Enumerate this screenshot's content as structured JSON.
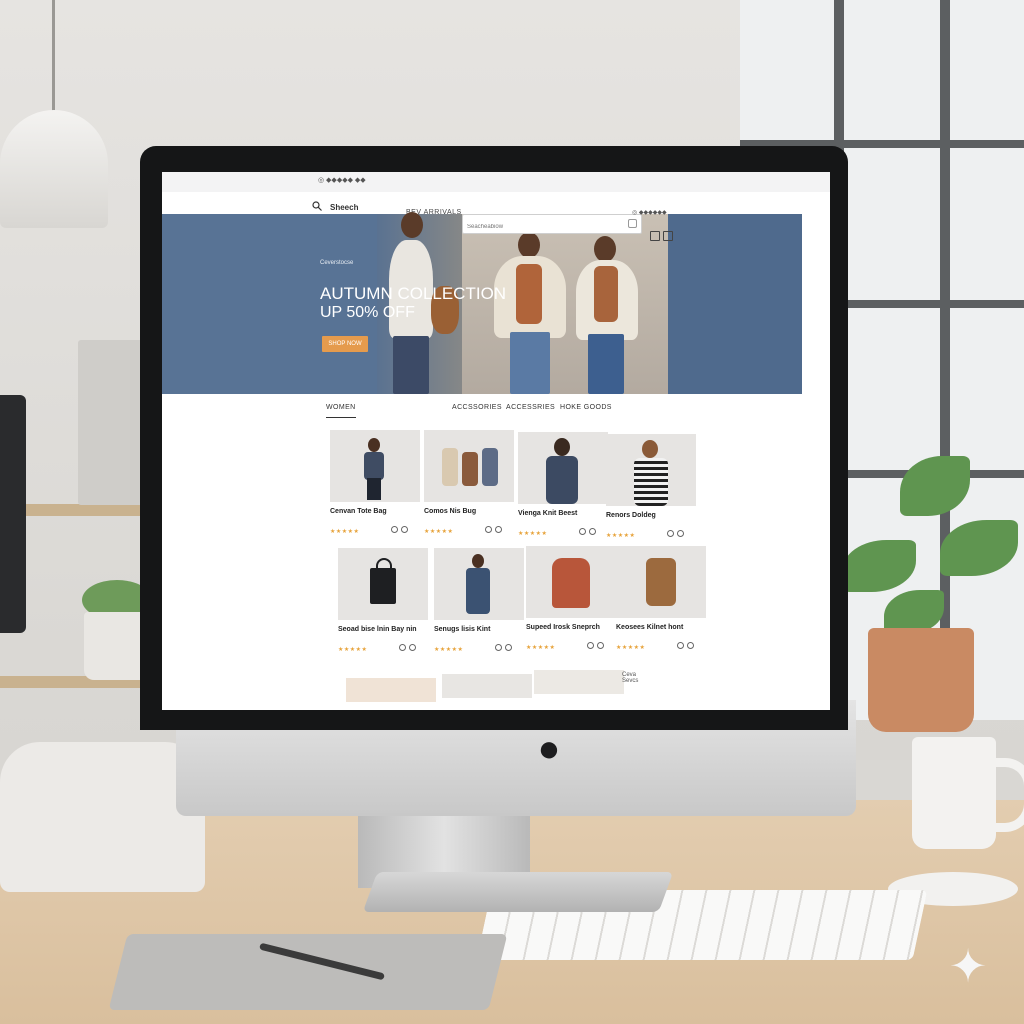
{
  "store": {
    "top_note": "◎ ◆◆◆◆◆ ◆◆",
    "search_label": "Sheech",
    "nav_new": "BEV ARRIVALS",
    "search_placeholder": "Seacheabiow",
    "account_note": "◎ ◆◆◆◆◆◆"
  },
  "hero": {
    "eyebrow": "Ceverstocse",
    "title": "AUTUMN COLLECTION",
    "subtitle": "UP 50% OFF",
    "button": "SHOP NOW"
  },
  "tabs": [
    {
      "label": "WOMEN"
    },
    {
      "label": "ACCSSORIES"
    },
    {
      "label": "ACCESSRIES"
    },
    {
      "label": "HOKE GOODS"
    }
  ],
  "products": [
    {
      "name": "Cenvan Tote Bag",
      "stars": "★★★★★",
      "rating": 5
    },
    {
      "name": "Comos Nis Bug",
      "stars": "★★★★★",
      "rating": 5
    },
    {
      "name": "Vienga Knit Beest",
      "stars": "★★★★★",
      "rating": 5
    },
    {
      "name": "Renors Doldeg",
      "stars": "★★★★★",
      "rating": 5
    },
    {
      "name": "Seoad bise lnin Bay nin",
      "stars": "★★★★★",
      "rating": 5
    },
    {
      "name": "Senugs lisis Kint",
      "stars": "★★★★★",
      "rating": 5
    },
    {
      "name": "Supeed Irosk Sneprch",
      "stars": "★★★★★",
      "rating": 5
    },
    {
      "name": "Keosees Kilnet hont",
      "stars": "★★★★★",
      "rating": 5
    }
  ],
  "footer_note": "Ceva  Sevcs",
  "colors": {
    "hero_blue": "#587395",
    "button_orange": "#e59b4d",
    "star": "#e7a33b"
  },
  "icons": [
    "search-icon",
    "cart-icon",
    "bag-icon",
    "apple-logo-icon",
    "sparkle-icon"
  ]
}
